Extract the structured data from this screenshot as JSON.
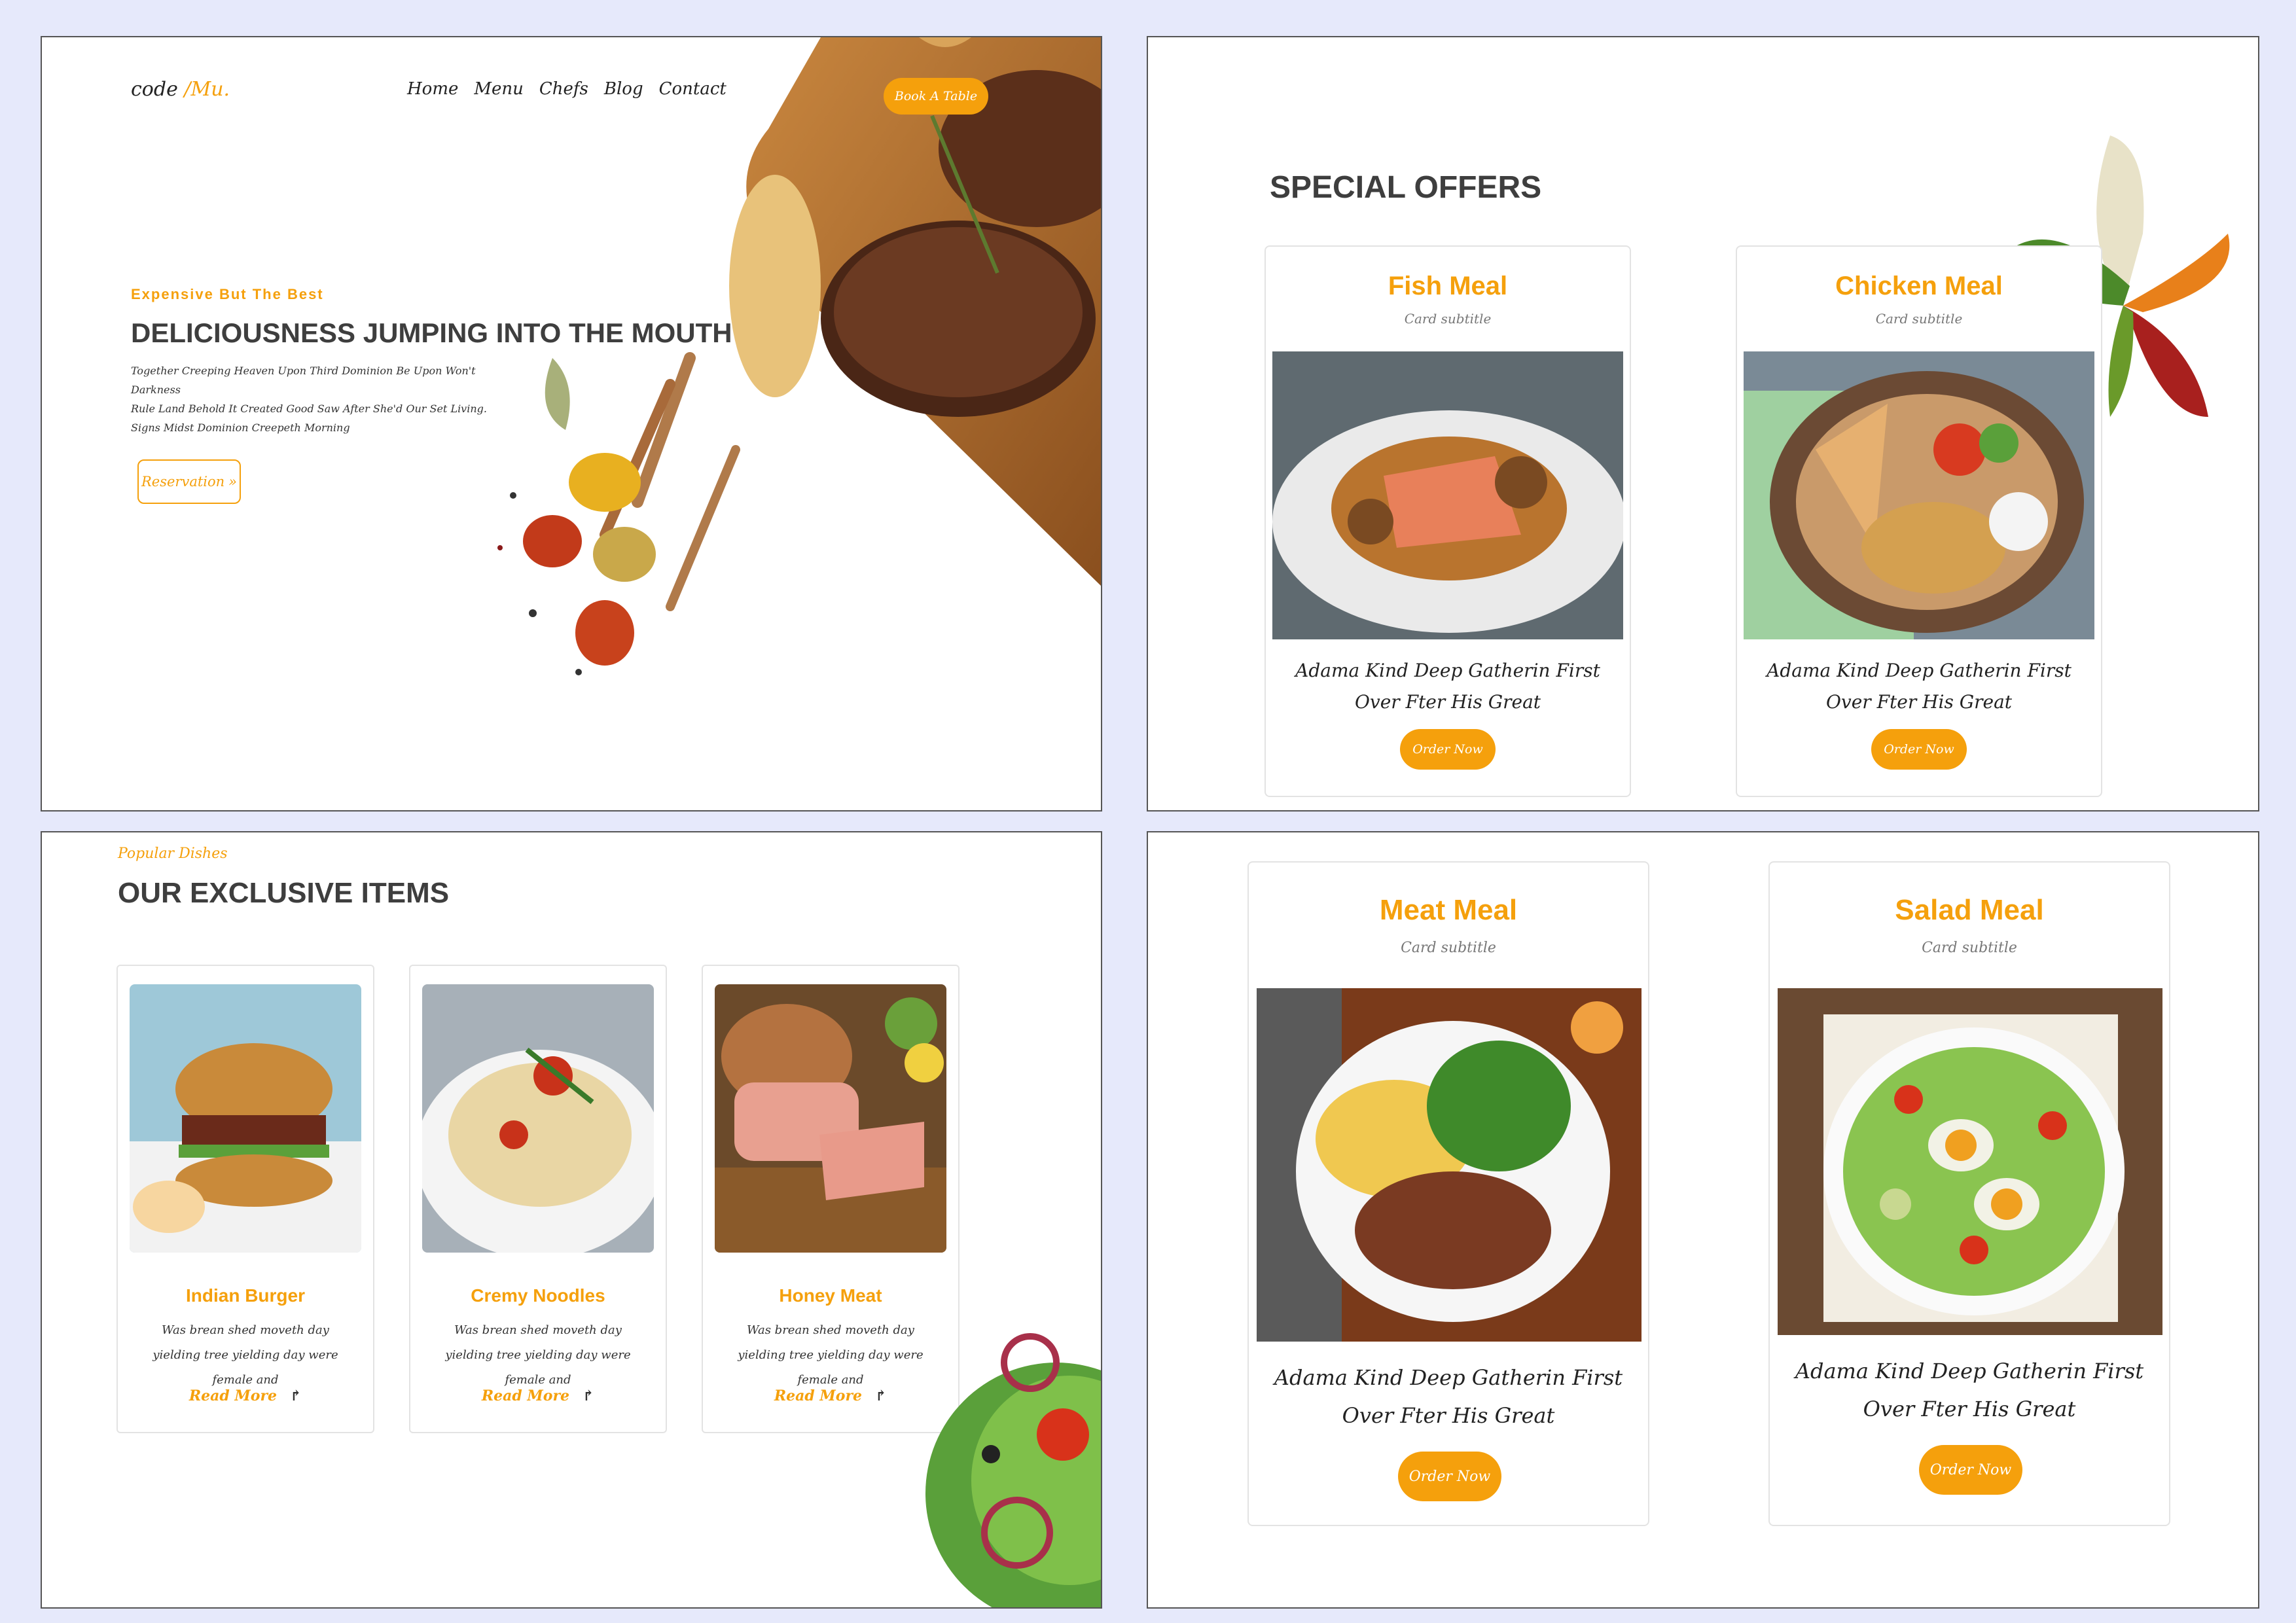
{
  "panel1": {
    "logo_main": "code",
    "logo_accent": " /Mu.",
    "nav": [
      "Home",
      "Menu",
      "Chefs",
      "Blog",
      "Contact"
    ],
    "book_button": "Book A Table",
    "tagline": "Expensive But The Best",
    "title": "DELICIOUSNESS JUMPING INTO THE MOUTH",
    "text_lines": [
      "Together Creeping Heaven Upon Third Dominion Be Upon Won't Darkness",
      "Rule Land Behold It Created Good Saw After She'd Our Set Living.",
      "Signs Midst Dominion Creepeth Morning"
    ],
    "reservation_button": "Reservation",
    "reservation_icon": "double-chevron-right-icon"
  },
  "panel2": {
    "title": "SPECIAL OFFERS",
    "cards": [
      {
        "title": "Fish Meal",
        "subtitle": "Card subtitle",
        "text": "Adama Kind Deep Gatherin First Over Fter His Great",
        "button": "Order Now"
      },
      {
        "title": "Chicken Meal",
        "subtitle": "Card subtitle",
        "text": "Adama Kind Deep Gatherin First Over Fter His Great",
        "button": "Order Now"
      }
    ]
  },
  "panel3": {
    "label": "Popular Dishes",
    "title": "OUR EXCLUSIVE ITEMS",
    "dishes": [
      {
        "title": "Indian Burger",
        "text": "Was brean shed moveth day yielding tree yielding day were female and",
        "link": "Read More"
      },
      {
        "title": "Cremy Noodles",
        "text": "Was brean shed moveth day yielding tree yielding day were female and",
        "link": "Read More"
      },
      {
        "title": "Honey Meat",
        "text": "Was brean shed moveth day yielding tree yielding day were female and",
        "link": "Read More"
      }
    ]
  },
  "panel4": {
    "cards": [
      {
        "title": "Meat Meal",
        "subtitle": "Card subtitle",
        "text": "Adama Kind Deep Gatherin First Over Fter His Great",
        "button": "Order Now"
      },
      {
        "title": "Salad Meal",
        "subtitle": "Card subtitle",
        "text": "Adama Kind Deep Gatherin First Over Fter His Great",
        "button": "Order Now"
      }
    ]
  },
  "colors": {
    "accent": "#f5a00c",
    "heading": "#3e3e3e",
    "page_bg": "#e6e9fb"
  }
}
